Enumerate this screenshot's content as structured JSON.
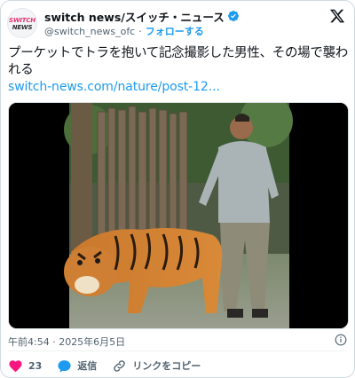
{
  "account": {
    "avatar_line1": "SWITCH",
    "avatar_line2": "NEWS",
    "display_name": "switch news/スイッチ・ニュース",
    "handle": "@switch_news_ofc",
    "separator": "·",
    "follow_label": "フォローする"
  },
  "post": {
    "text": "プーケットでトラを抱いて記念撮影した男性、その場で襲われる",
    "link": "switch-news.com/nature/post-12...",
    "timestamp": "午前4:54 · 2025年6月5日"
  },
  "actions": {
    "like_count": "23",
    "reply_label": "返信",
    "copy_label": "リンクをコピー"
  },
  "colors": {
    "accent": "#1d9bf0",
    "like": "#f91880",
    "text": "#0f1419",
    "muted": "#536471"
  },
  "icons": [
    "verified-badge-icon",
    "x-logo-icon",
    "info-icon",
    "heart-icon",
    "reply-icon",
    "link-icon"
  ]
}
